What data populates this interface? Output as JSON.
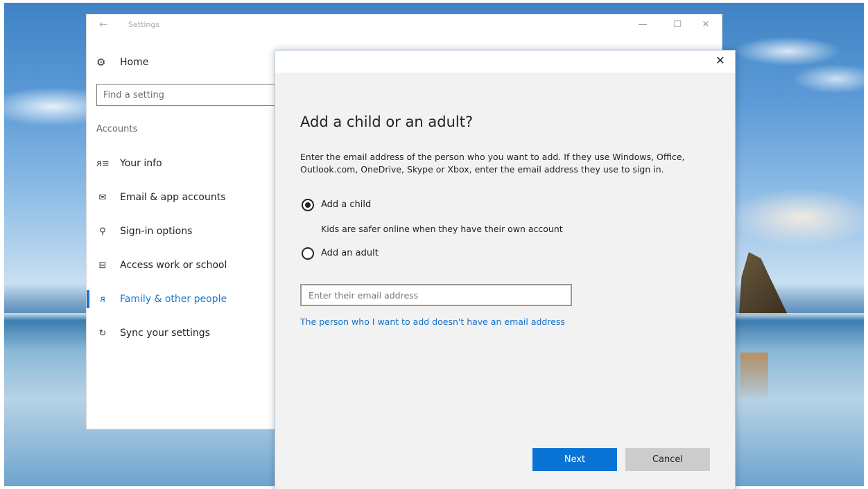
{
  "window": {
    "title": "Settings",
    "back_glyph": "←",
    "minimize_glyph": "—",
    "maximize_glyph": "☐",
    "close_glyph": "✕"
  },
  "sidebar": {
    "home_label": "Home",
    "home_icon": "gear-icon",
    "search_placeholder": "Find a setting",
    "section_title": "Accounts",
    "items": [
      {
        "label": "Your info",
        "icon": "person-card-icon",
        "glyph": "ᴙ≡",
        "active": false
      },
      {
        "label": "Email & app accounts",
        "icon": "mail-icon",
        "glyph": "✉",
        "active": false
      },
      {
        "label": "Sign-in options",
        "icon": "key-icon",
        "glyph": "⚲",
        "active": false
      },
      {
        "label": "Access work or school",
        "icon": "briefcase-icon",
        "glyph": "⊟",
        "active": false
      },
      {
        "label": "Family & other people",
        "icon": "person-icon",
        "glyph": "ᴙ",
        "active": true
      },
      {
        "label": "Sync your settings",
        "icon": "sync-icon",
        "glyph": "↻",
        "active": false
      }
    ]
  },
  "dialog": {
    "close_glyph": "✕",
    "title": "Add a child or an adult?",
    "description": "Enter the email address of the person who you want to add. If they use Windows, Office, Outlook.com, OneDrive, Skype or Xbox, enter the email address they use to sign in.",
    "options": [
      {
        "label": "Add a child",
        "selected": true
      },
      {
        "label": "Add an adult",
        "selected": false
      }
    ],
    "child_note": "Kids are safer online when they have their own account",
    "email_placeholder": "Enter their email address",
    "no_email_link": "The person who I want to add doesn't have an email address",
    "next_label": "Next",
    "cancel_label": "Cancel"
  },
  "colors": {
    "accent": "#1976d2",
    "link": "#1270c8",
    "next_button": "#0a74d6",
    "cancel_button": "#cccccc",
    "dialog_bg": "#f2f2f2"
  }
}
